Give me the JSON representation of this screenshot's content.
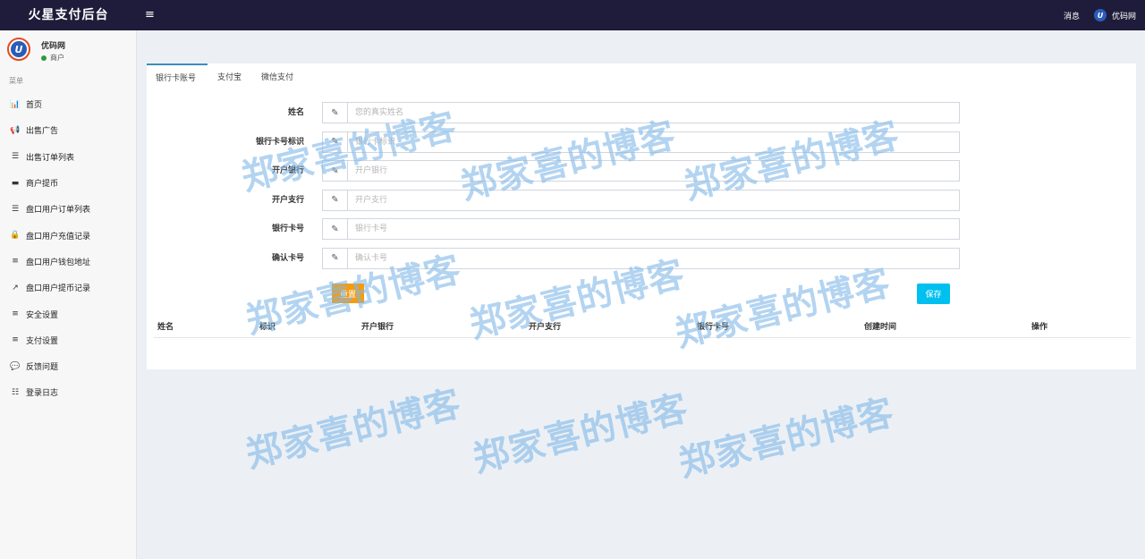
{
  "app": {
    "title": "火星支付后台",
    "menu_toggle": "≡"
  },
  "topbar": {
    "messages": "消息",
    "username": "优码网",
    "logo_letter": "U"
  },
  "sidebar": {
    "user_name": "优码网",
    "user_role": "商户",
    "avatar_letter": "U",
    "menu_header": "菜单",
    "items": [
      {
        "icon": "bar-chart-icon",
        "glyph": "📊",
        "label": "首页"
      },
      {
        "icon": "bullhorn-icon",
        "glyph": "📢",
        "label": "出售广告"
      },
      {
        "icon": "list-icon",
        "glyph": "☰",
        "label": "出售订单列表"
      },
      {
        "icon": "credit-card-icon",
        "glyph": "▬",
        "label": "商户提币"
      },
      {
        "icon": "list-icon",
        "glyph": "☰",
        "label": "盘口用户订单列表"
      },
      {
        "icon": "lock-icon",
        "glyph": "🔒",
        "label": "盘口用户充值记录"
      },
      {
        "icon": "bars-icon",
        "glyph": "≡",
        "label": "盘口用户钱包地址"
      },
      {
        "icon": "external-link-icon",
        "glyph": "↗",
        "label": "盘口用户提币记录"
      },
      {
        "icon": "bars-icon",
        "glyph": "≡",
        "label": "安全设置"
      },
      {
        "icon": "bars-icon",
        "glyph": "≡",
        "label": "支付设置"
      },
      {
        "icon": "comment-icon",
        "glyph": "💬",
        "label": "反馈问题"
      },
      {
        "icon": "list-ol-icon",
        "glyph": "☷",
        "label": "登录日志"
      }
    ]
  },
  "tabs": [
    "银行卡账号",
    "支付宝",
    "微信支付"
  ],
  "form": {
    "addon_icon": "✎",
    "fields": [
      {
        "label": "姓名",
        "placeholder": "您的真实姓名",
        "value": ""
      },
      {
        "label": "银行卡号标识",
        "placeholder": "银行卡标识",
        "value": ""
      },
      {
        "label": "开户银行",
        "placeholder": "开户银行",
        "value": ""
      },
      {
        "label": "开户支行",
        "placeholder": "开户支行",
        "value": ""
      },
      {
        "label": "银行卡号",
        "placeholder": "银行卡号",
        "value": ""
      },
      {
        "label": "确认卡号",
        "placeholder": "确认卡号",
        "value": ""
      }
    ],
    "orange_button": "重置",
    "save_button": "保存"
  },
  "table": {
    "columns": [
      "姓名",
      "标识",
      "开户银行",
      "开户支行",
      "银行卡号",
      "创建时间",
      "操作"
    ]
  },
  "watermark": "郑家喜的博客",
  "colors": {
    "topbar": "#1e1c3a",
    "accent": "#3c8dbc",
    "save": "#00c0ef",
    "orange": "#f39c12",
    "watermark": "#80b8e8"
  }
}
